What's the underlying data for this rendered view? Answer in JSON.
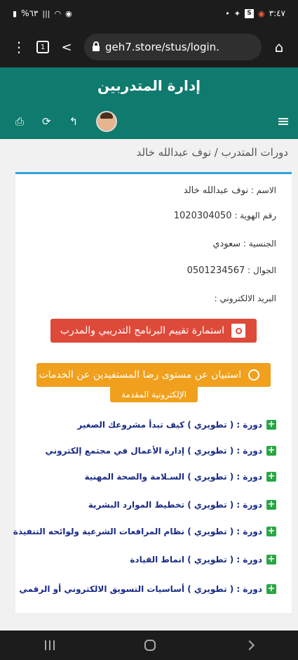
{
  "status_bar": {
    "left_text": "%٦٣",
    "signal_text": "|||",
    "time": "٣:٤٧",
    "badge_s": "S"
  },
  "browser": {
    "url": "geh7.store/stus/login.",
    "tab_count": "1"
  },
  "app": {
    "title": "إدارة المتدربين",
    "breadcrumb": "دورات المتدرب / نوف عبدالله خالد"
  },
  "profile": {
    "name_label": "الاسم :",
    "name_value": "نوف عبدالله خالد",
    "id_label": "رقم الهوية :",
    "id_value": "1020304050",
    "nationality_label": "الجنسية :",
    "nationality_value": "سعودي",
    "mobile_label": "الجوال :",
    "mobile_value": "0501234567",
    "email_label": "البريد الالكتروني :"
  },
  "actions": {
    "evaluation_form": "استمارة تقييم البرنامج التدريبي والمدرب",
    "survey_line1": "استبيان عن مستوى رضا المستفيدين عن الخدمات",
    "survey_line2": "الإلكترونية المقدمة"
  },
  "courses": [
    "دورة : ( تطويري ) كيف تبدأ مشروعك الصغير",
    "دورة : ( تطويري ) إدارة الأعمال في مجتمع إلكتروني",
    "دورة : ( تطويري ) السـلامة والصحة المهنية",
    "دورة : ( تطويري ) تخطيط الموارد البشرية",
    "دورة : ( تطويري ) نظام المرافعات الشرعية ولوائحه التنفيذة",
    "دورة : ( تطويري ) انماط القيادة",
    "دورة : ( تطويري ) أساسيات التسويق الالكتروني أو الرقمي"
  ],
  "colors": {
    "header_bg": "#0f7a6e",
    "accent_blue": "#2fa3dd",
    "red_button": "#de4a3a",
    "orange_button": "#f0a01c",
    "course_text": "#1a2a86",
    "plus_icon": "#28a745"
  },
  "icons": {
    "print": "print-icon",
    "refresh": "refresh-icon",
    "back": "reply-icon",
    "avatar": "user-avatar",
    "menu": "hamburger-icon"
  }
}
